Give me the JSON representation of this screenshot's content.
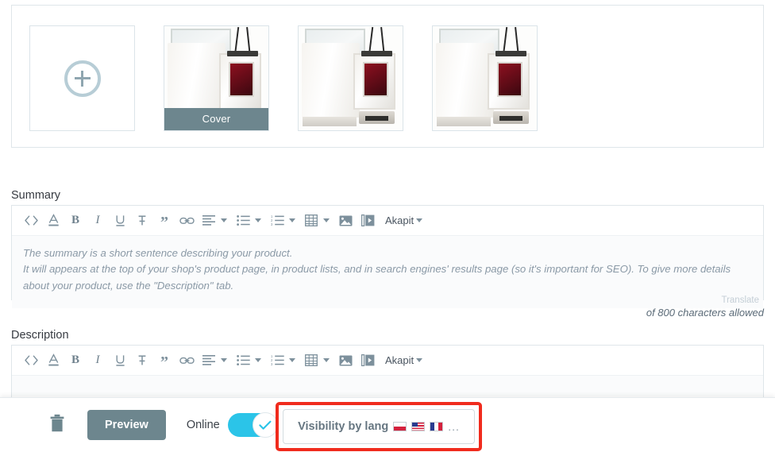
{
  "gallery": {
    "add_tile_label": "add-image",
    "thumbnails": [
      {
        "name": "add-placeholder",
        "badge": ""
      },
      {
        "name": "window-profile-1",
        "badge": "Cover"
      },
      {
        "name": "window-profile-2",
        "badge": ""
      },
      {
        "name": "window-profile-3",
        "badge": ""
      }
    ]
  },
  "summary": {
    "label": "Summary",
    "placeholder_line1": "The summary is a short sentence describing your product.",
    "placeholder_line2": "It will appears at the top of your shop's product page, in product lists, and in search engines' results page (so it's important for SEO). To give more details about your product, use the \"Description\" tab.",
    "translate_label": "Translate",
    "char_count": "of 800 characters allowed"
  },
  "description": {
    "label": "Description"
  },
  "toolbar": {
    "source_code": "<>",
    "text_color": "A",
    "bold": "B",
    "italic": "I",
    "underline": "U",
    "strikethrough": "S",
    "quote": "”",
    "link": "link",
    "align": "align-left",
    "bullet_list": "bullet-list",
    "numbered_list": "numbered-list",
    "table": "table",
    "image": "image",
    "video": "video",
    "paragraph_label": "Akapit"
  },
  "footer": {
    "delete_label": "delete",
    "preview_label": "Preview",
    "online_label": "Online",
    "online_state": "on",
    "visibility_label": "Visibility by lang",
    "visibility_flags": [
      "pl",
      "us",
      "fr"
    ],
    "visibility_more": "..."
  },
  "colors": {
    "accent_teal": "#6d868e",
    "toggle_on": "#2bc4e8",
    "highlight_red": "#f02b1d",
    "border": "#dfe6ea"
  }
}
